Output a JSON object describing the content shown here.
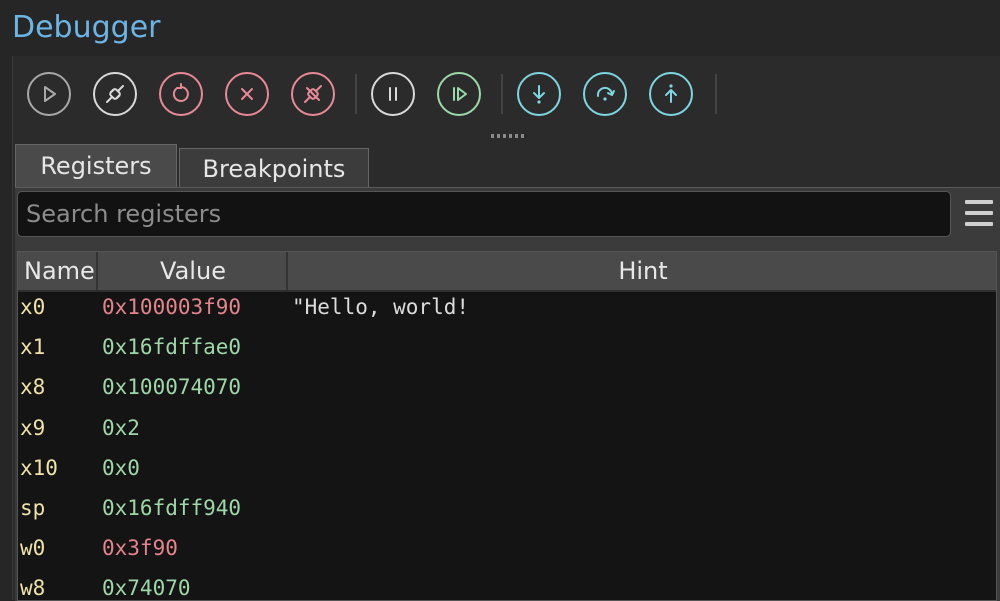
{
  "window": {
    "title": "Debugger"
  },
  "toolbar": {
    "buttons": [
      {
        "name": "run-button",
        "icon": "play-icon",
        "color": "#a8a8a8"
      },
      {
        "name": "attach-button",
        "icon": "plug-icon",
        "color": "#d9d9d9"
      },
      {
        "name": "restart-button",
        "icon": "restart-icon",
        "color": "#e88a95"
      },
      {
        "name": "stop-button",
        "icon": "close-icon",
        "color": "#e88a95"
      },
      {
        "name": "detach-button",
        "icon": "unplug-icon",
        "color": "#e88a95"
      },
      {
        "name": "pause-button",
        "icon": "pause-icon",
        "color": "#d9d9d9"
      },
      {
        "name": "resume-button",
        "icon": "step-resume-icon",
        "color": "#9bd9a8"
      },
      {
        "name": "step-into-button",
        "icon": "step-into-icon",
        "color": "#7ed6e0"
      },
      {
        "name": "step-over-button",
        "icon": "step-over-icon",
        "color": "#7ed6e0"
      },
      {
        "name": "step-out-button",
        "icon": "step-out-icon",
        "color": "#7ed6e0"
      }
    ]
  },
  "tabs": [
    {
      "label": "Registers",
      "active": true
    },
    {
      "label": "Breakpoints",
      "active": false
    }
  ],
  "search": {
    "placeholder": "Search registers"
  },
  "table": {
    "columns": {
      "name": "Name",
      "value": "Value",
      "hint": "Hint"
    },
    "rows": [
      {
        "name": "x0",
        "value": "0x100003f90",
        "hint": "\"Hello, world!",
        "value_color": "#e5848c"
      },
      {
        "name": "x1",
        "value": "0x16fdffae0",
        "hint": "",
        "value_color": "#9ed7a8"
      },
      {
        "name": "x8",
        "value": "0x100074070",
        "hint": "",
        "value_color": "#9ed7a8"
      },
      {
        "name": "x9",
        "value": "0x2",
        "hint": "",
        "value_color": "#9ed7a8"
      },
      {
        "name": "x10",
        "value": "0x0",
        "hint": "",
        "value_color": "#9ed7a8"
      },
      {
        "name": "sp",
        "value": "0x16fdff940",
        "hint": "",
        "value_color": "#9ed7a8"
      },
      {
        "name": "w0",
        "value": "0x3f90",
        "hint": "",
        "value_color": "#e5848c"
      },
      {
        "name": "w8",
        "value": "0x74070",
        "hint": "",
        "value_color": "#9ed7a8"
      }
    ]
  }
}
